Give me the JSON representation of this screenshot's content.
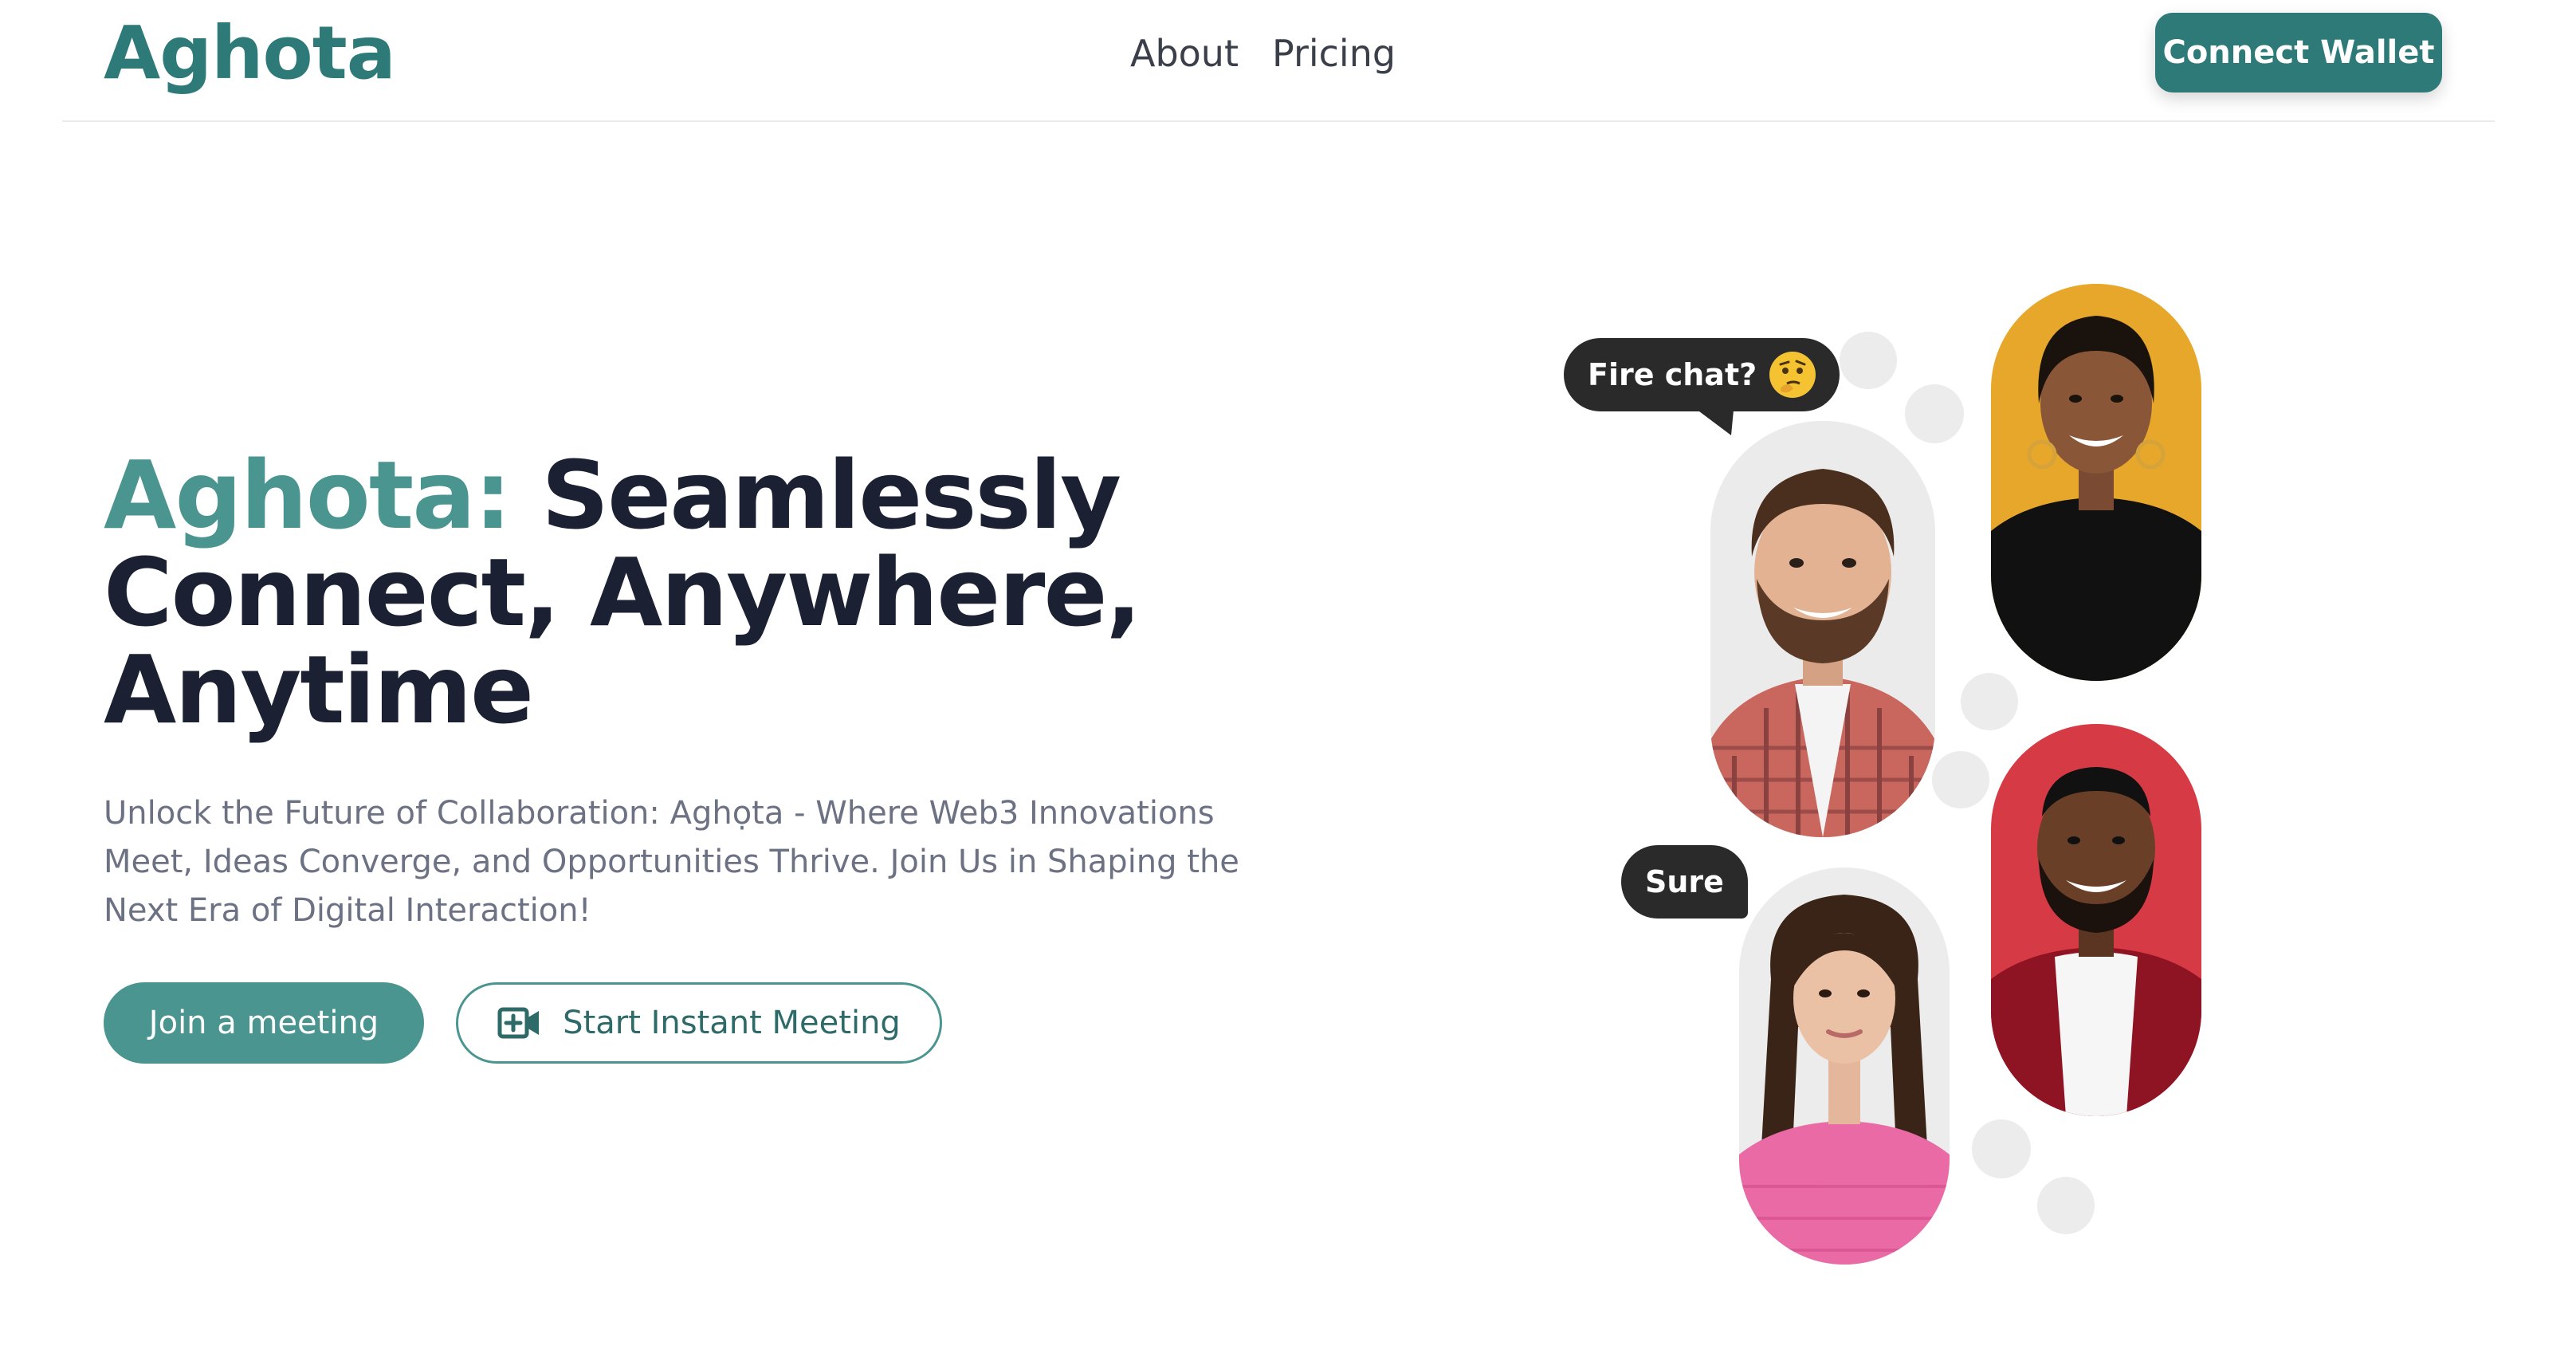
{
  "header": {
    "logo": "Aghota",
    "nav": [
      "About",
      "Pricing"
    ],
    "connect_label": "Connect Wallet"
  },
  "hero": {
    "title_brand": "Aghota:",
    "title_rest": "Seamlessly Connect, Anywhere, Anytime",
    "description": "Unlock the Future of Collaboration: Aghọta - Where Web3 Innovations Meet, Ideas Converge, and Opportunities Thrive. Join Us in Shaping the Next Era of Digital Interaction!",
    "join_label": "Join a meeting",
    "instant_label": "Start Instant Meeting"
  },
  "illustration": {
    "bubble_fire": "Fire chat?",
    "bubble_sure": "Sure"
  },
  "colors": {
    "brand": "#2e7a78",
    "brand_light": "#4a9590",
    "heading": "#1b2133",
    "muted": "#6c7184"
  }
}
